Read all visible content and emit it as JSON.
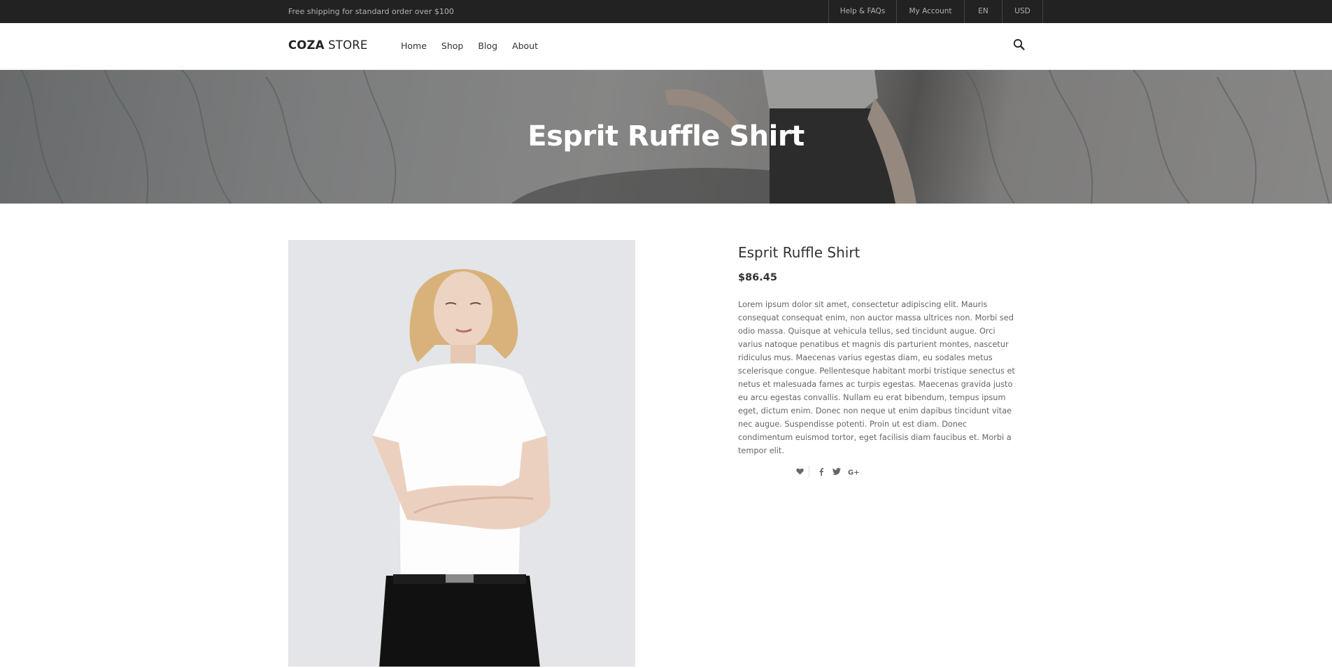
{
  "topbar": {
    "promo": "Free shipping for standard order over $100",
    "links": [
      "Help & FAQs",
      "My Account",
      "EN",
      "USD"
    ]
  },
  "header": {
    "logo_bold": "COZA",
    "logo_rest": " STORE",
    "nav": [
      "Home",
      "Shop",
      "Blog",
      "About"
    ],
    "search_icon": "search-icon"
  },
  "hero": {
    "title": "Esprit Ruffle Shirt"
  },
  "product": {
    "name": "Esprit Ruffle Shirt",
    "price": "$86.45",
    "description": "Lorem ipsum dolor sit amet, consectetur adipiscing elit. Mauris consequat consequat enim, non auctor massa ultrices non. Morbi sed odio massa. Quisque at vehicula tellus, sed tincidunt augue. Orci varius natoque penatibus et magnis dis parturient montes, nascetur ridiculus mus. Maecenas varius egestas diam, eu sodales metus scelerisque congue. Pellentesque habitant morbi tristique senectus et netus et malesuada fames ac turpis egestas. Maecenas gravida justo eu arcu egestas convallis. Nullam eu erat bibendum, tempus ipsum eget, dictum enim. Donec non neque ut enim dapibus tincidunt vitae nec augue. Suspendisse potenti. Proin ut est diam. Donec condimentum euismod tortor, eget facilisis diam faucibus et. Morbi a tempor elit.",
    "social_icons": [
      "heart-icon",
      "facebook-icon",
      "twitter-icon",
      "google-plus-icon"
    ]
  },
  "colors": {
    "topbar_bg": "#222222",
    "text_dark": "#333333",
    "text_muted": "#666666"
  }
}
